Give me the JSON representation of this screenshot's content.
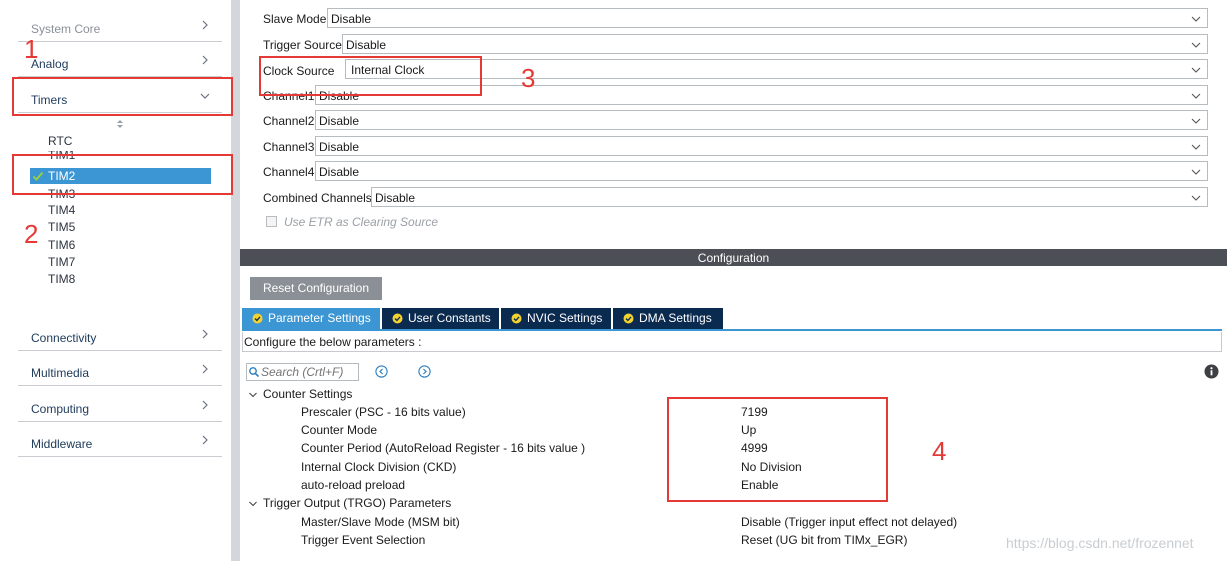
{
  "sidebar": {
    "categories": [
      {
        "label": "System Core"
      },
      {
        "label": "Analog"
      },
      {
        "label": "Timers"
      },
      {
        "label": "Connectivity"
      },
      {
        "label": "Multimedia"
      },
      {
        "label": "Computing"
      },
      {
        "label": "Middleware"
      }
    ],
    "timers": [
      {
        "label": "RTC"
      },
      {
        "label": "TIM1"
      },
      {
        "label": "TIM2",
        "selected": true
      },
      {
        "label": "TIM3"
      },
      {
        "label": "TIM4"
      },
      {
        "label": "TIM5"
      },
      {
        "label": "TIM6"
      },
      {
        "label": "TIM7"
      },
      {
        "label": "TIM8"
      }
    ]
  },
  "mode": {
    "rows": [
      {
        "label": "Slave Mode",
        "value": "Disable"
      },
      {
        "label": "Trigger Source",
        "value": "Disable"
      },
      {
        "label": "Clock Source",
        "value": "Internal Clock"
      },
      {
        "label": "Channel1",
        "value": "Disable"
      },
      {
        "label": "Channel2",
        "value": "Disable"
      },
      {
        "label": "Channel3",
        "value": "Disable"
      },
      {
        "label": "Channel4",
        "value": "Disable"
      },
      {
        "label": "Combined Channels",
        "value": "Disable"
      }
    ],
    "etr_label": "Use ETR as Clearing Source"
  },
  "config": {
    "header": "Configuration",
    "reset_label": "Reset Configuration",
    "tabs": [
      {
        "label": "Parameter Settings",
        "active": true
      },
      {
        "label": "User Constants"
      },
      {
        "label": "NVIC Settings"
      },
      {
        "label": "DMA Settings"
      }
    ],
    "configure_text": "Configure the below parameters :",
    "search_placeholder": "Search (Crtl+F)",
    "groups": [
      {
        "label": "Counter Settings",
        "params": [
          {
            "name": "Prescaler (PSC - 16 bits value)",
            "value": "7199"
          },
          {
            "name": "Counter Mode",
            "value": "Up"
          },
          {
            "name": "Counter Period (AutoReload Register - 16 bits value )",
            "value": "4999"
          },
          {
            "name": "Internal Clock Division (CKD)",
            "value": "No Division"
          },
          {
            "name": "auto-reload preload",
            "value": "Enable"
          }
        ]
      },
      {
        "label": "Trigger Output (TRGO) Parameters",
        "params": [
          {
            "name": "Master/Slave Mode (MSM bit)",
            "value": "Disable (Trigger input effect not delayed)"
          },
          {
            "name": "Trigger Event Selection",
            "value": "Reset (UG bit from TIMx_EGR)"
          }
        ]
      }
    ]
  },
  "annotations": [
    "1",
    "2",
    "3",
    "4"
  ],
  "watermark": "https://blog.csdn.net/frozennet",
  "colors": {
    "accent": "#3d96d4",
    "tab_dark": "#0b2a4f",
    "header_dark": "#4c4f55",
    "annotation_red": "#e53935",
    "check_green": "#9bd23b"
  }
}
